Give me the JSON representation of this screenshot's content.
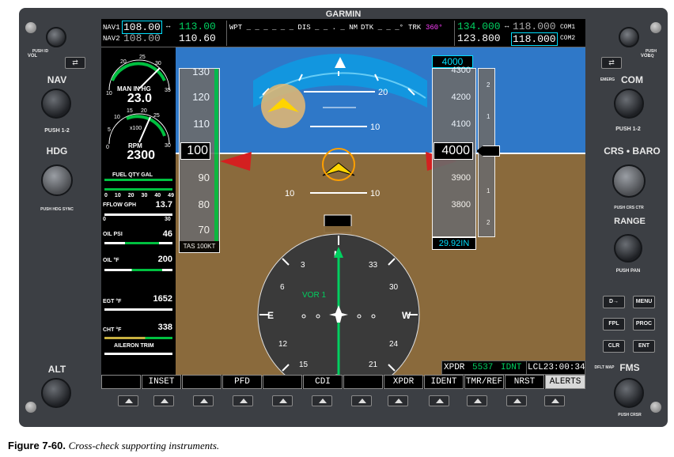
{
  "brand": "GARMIN",
  "caption": {
    "figure": "Figure 7-60.",
    "text": "Cross-check supporting instruments."
  },
  "left_bezel": {
    "vol_label": "VOL",
    "push_id": "PUSH ID",
    "nav_label": "NAV",
    "push_12": "PUSH 1-2",
    "hdg_label": "HDG",
    "push_hdg_sync": "PUSH HDG SYNC",
    "alt_label": "ALT"
  },
  "right_bezel": {
    "vol_label": "VOL",
    "push_sq": "PUSH SQ",
    "emerg": "EMERG",
    "com_label": "COM",
    "push_12": "PUSH 1-2",
    "crs_baro_label": "CRS • BARO",
    "push_crs_ctr": "PUSH CRS CTR",
    "range_label": "RANGE",
    "push_pan": "PUSH PAN",
    "buttons": [
      "D→",
      "MENU",
      "FPL",
      "PROC",
      "CLR",
      "ENT"
    ],
    "dflt_map": "DFLT MAP",
    "fms_label": "FMS",
    "push_crsr": "PUSH CRSR"
  },
  "nav_bar": {
    "nav1_label": "NAV1",
    "nav1_standby": "108.00",
    "nav1_active": "113.00",
    "nav2_label": "NAV2",
    "nav2_standby": "108.00",
    "nav2_active": "110.60",
    "wpt": "WPT _ _ _ _ _ _ DIS _ _ . _ NM",
    "dtk": "DTK _ _ _°",
    "trk_label": "TRK",
    "trk_value": "360°",
    "com1_active": "134.000",
    "com1_standby": "118.000",
    "com1_label": "COM1",
    "com2_active": "123.800",
    "com2_standby": "118.000",
    "com2_label": "COM2"
  },
  "eis": {
    "man_label": "MAN IN HG",
    "man_value": "23.0",
    "rpm_label": "RPM",
    "rpm_value": "2300",
    "rpm_x100": "x100",
    "fuel_qty": "FUEL QTY GAL",
    "fuel_ticks": [
      "0",
      "10",
      "20",
      "30",
      "40",
      "49"
    ],
    "fflow_label": "FFLOW GPH",
    "fflow_value": "13.7",
    "fflow_ticks": [
      "0",
      "30"
    ],
    "oil_psi_label": "OIL PSI",
    "oil_psi_value": "46",
    "oil_f_label": "OIL °F",
    "oil_f_value": "200",
    "egt_label": "EGT °F",
    "egt_value": "1652",
    "cht_label": "CHT °F",
    "cht_value": "338",
    "aileron_trim": "AILERON TRIM",
    "man_ticks": [
      "10",
      "20",
      "25",
      "30",
      "35"
    ],
    "rpm_ticks": [
      "0",
      "5",
      "10",
      "15",
      "20",
      "25",
      "30"
    ]
  },
  "airspeed": {
    "ticks": [
      "130",
      "120",
      "110",
      "100",
      "90",
      "80",
      "70"
    ],
    "current": "100",
    "tas": "TAS 100KT"
  },
  "altitude": {
    "selected": "4000",
    "ticks": [
      "4300",
      "4200",
      "4100",
      "3900",
      "3800"
    ],
    "current": "4000",
    "baro": "29.92IN",
    "vsi_ticks": [
      "2",
      "1",
      "1",
      "2"
    ]
  },
  "attitude": {
    "pitch_labels": [
      "20",
      "10",
      "10"
    ]
  },
  "hsi": {
    "nav_source": "VOR 1",
    "headings": [
      "N",
      "3",
      "6",
      "E",
      "12",
      "15",
      "S",
      "21",
      "24",
      "W",
      "30",
      "33"
    ]
  },
  "status": {
    "xpdr_label": "XPDR",
    "xpdr_code": "5537",
    "xpdr_mode": "IDNT",
    "lcl_time": "LCL23:00:34"
  },
  "softkeys": [
    "",
    "INSET",
    "",
    "PFD",
    "",
    "CDI",
    "",
    "XPDR",
    "IDENT",
    "TMR/REF",
    "NRST",
    "ALERTS"
  ],
  "colors": {
    "sky": "#2f78c8",
    "ground": "#8a6a3c",
    "tape_bg": "#6b6b6b",
    "frame": "#3c3f44",
    "cyan": "#00e0ff",
    "magenta": "#ff40ff",
    "green": "#00d060"
  }
}
